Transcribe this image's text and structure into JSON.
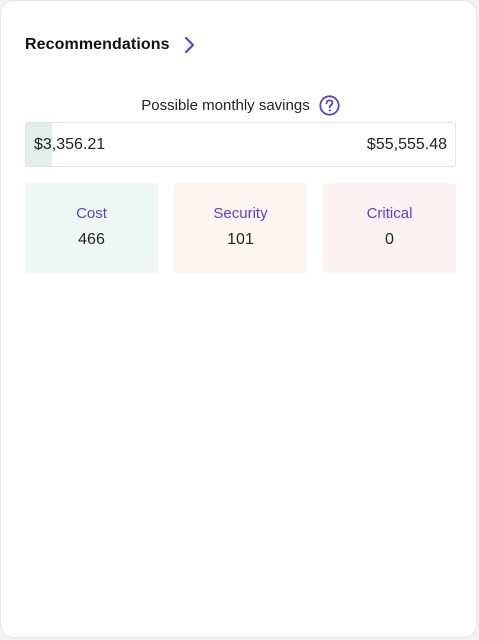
{
  "header": {
    "title": "Recommendations",
    "chevron_icon": "chevron-right-icon"
  },
  "savings": {
    "label": "Possible monthly savings",
    "help_icon": "question-circle-icon",
    "current": "$3,356.21",
    "max": "$55,555.48",
    "fill_fraction": 0.06
  },
  "tiles": [
    {
      "label": "Cost",
      "value": "466",
      "bg": "#f0f6f3"
    },
    {
      "label": "Security",
      "value": "101",
      "bg": "#fcf6f2"
    },
    {
      "label": "Critical",
      "value": "0",
      "bg": "#fcf2f3"
    }
  ],
  "colors": {
    "accent": "#5a3fd6",
    "text": "#222222",
    "savings_fill": "#e2eeea"
  }
}
